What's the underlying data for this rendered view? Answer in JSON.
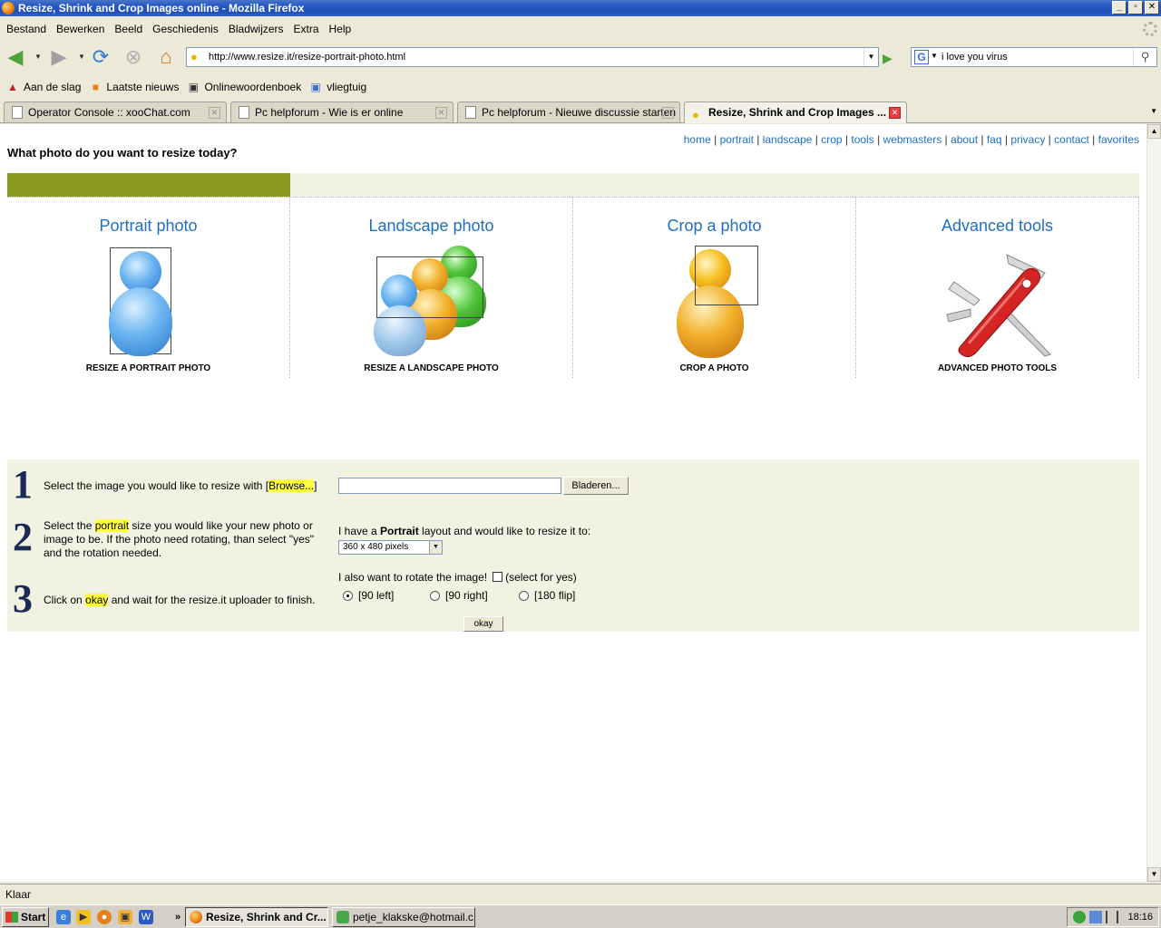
{
  "window": {
    "title": "Resize, Shrink and Crop Images online - Mozilla Firefox",
    "controls": [
      "_",
      "▫",
      "✕"
    ]
  },
  "menu": [
    "Bestand",
    "Bewerken",
    "Beeld",
    "Geschiedenis",
    "Bladwijzers",
    "Extra",
    "Help"
  ],
  "nav": {
    "url": "http://www.resize.it/resize-portrait-photo.html",
    "search_value": "i love you virus"
  },
  "bookmarks": [
    "Aan de slag",
    "Laatste nieuws",
    "Onlinewoordenboek",
    "vliegtuig"
  ],
  "tabs": [
    {
      "label": "Operator Console :: xooChat.com"
    },
    {
      "label": "Pc helpforum - Wie is er online"
    },
    {
      "label": "Pc helpforum - Nieuwe discussie starten"
    },
    {
      "label": "Resize, Shrink and Crop Images ..."
    }
  ],
  "page": {
    "headline": "What photo do you want to resize today?",
    "links": [
      "home",
      "portrait",
      "landscape",
      "crop",
      "tools",
      "webmasters",
      "about",
      "faq",
      "privacy",
      "contact",
      "favorites"
    ],
    "categories": [
      {
        "title": "Portrait photo",
        "caption": "RESIZE A PORTRAIT PHOTO"
      },
      {
        "title": "Landscape photo",
        "caption": "RESIZE A LANDSCAPE PHOTO"
      },
      {
        "title": "Crop a photo",
        "caption": "CROP A PHOTO"
      },
      {
        "title": "Advanced tools",
        "caption": "ADVANCED PHOTO TOOLS"
      }
    ],
    "form": {
      "step1_pre": "Select the image you would like to resize with [",
      "step1_hl": "Browse...",
      "step1_post": "]",
      "browse_button": "Bladeren...",
      "step2_pre": "Select the ",
      "step2_hl": "portrait",
      "step2_post": " size you would like your new photo or image to be. If the photo need rotating, than select \"yes\" and the rotation needed.",
      "layout_pre": "I have a ",
      "layout_bold": "Portrait",
      "layout_post": " layout and would like to resize it to:",
      "size_selected": "360 x 480 pixels",
      "rotate_label": "I also want to rotate the image!",
      "rotate_hint": "(select for yes)",
      "radios": [
        "[90 left]",
        "[90 right]",
        "[180 flip]"
      ],
      "step3_pre": "Click on ",
      "step3_hl": "okay",
      "step3_post": " and wait for the resize.it uploader to finish.",
      "ok_button": "okay"
    }
  },
  "status": "Klaar",
  "taskbar": {
    "start": "Start",
    "items": [
      "Resize, Shrink and Cr...",
      "petje_klakske@hotmail.c..."
    ],
    "clock": "18:16"
  }
}
